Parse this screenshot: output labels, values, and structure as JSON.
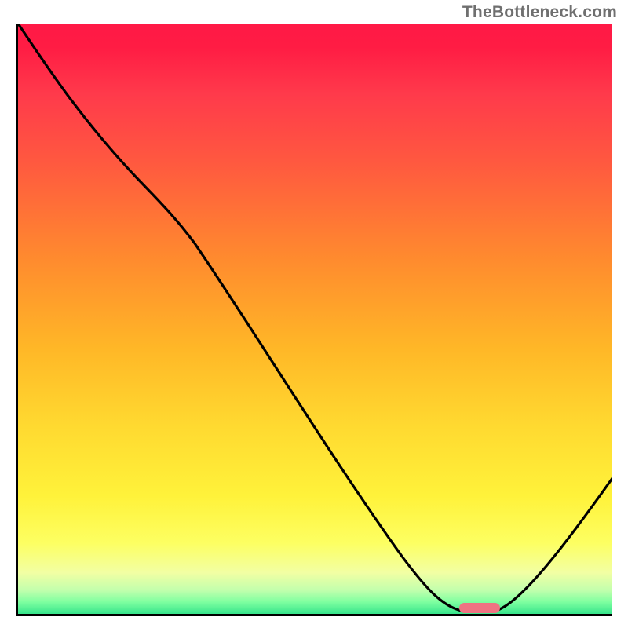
{
  "watermark": "TheBottleneck.com",
  "colors": {
    "gradient_top": "#ff1946",
    "gradient_mid": "#ffd930",
    "gradient_bottom": "#37e58c",
    "curve_stroke": "#000000",
    "pill_fill": "#ef7382",
    "axis": "#000000"
  },
  "chart_data": {
    "type": "line",
    "title": "",
    "xlabel": "",
    "ylabel": "",
    "xlim": [
      0,
      100
    ],
    "ylim": [
      0,
      100
    ],
    "series": [
      {
        "name": "curve",
        "x": [
          0,
          12,
          22,
          30,
          40,
          50,
          60,
          68,
          72,
          76,
          80,
          83,
          88,
          94,
          100
        ],
        "values": [
          100,
          90,
          80,
          72,
          57,
          42,
          27,
          12,
          4,
          1,
          0,
          0.5,
          6,
          14,
          24
        ]
      }
    ],
    "marker": {
      "name": "optimal-region",
      "x_center": 78,
      "y": 0.5,
      "width_pct": 7
    },
    "annotations": []
  }
}
